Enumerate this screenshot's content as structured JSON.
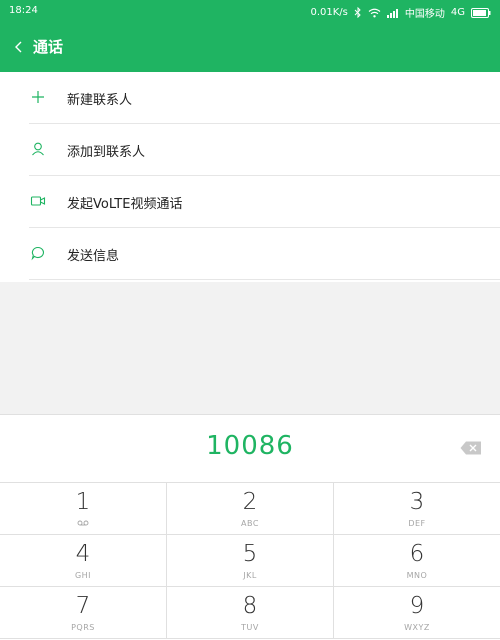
{
  "status": {
    "time": "18:24",
    "speed": "0.01K/s",
    "carrier": "中国移动",
    "network": "4G"
  },
  "appbar": {
    "title": "通话"
  },
  "menu": [
    {
      "label": "新建联系人",
      "icon": "plus-icon"
    },
    {
      "label": "添加到联系人",
      "icon": "person-icon"
    },
    {
      "label": "发起VoLTE视频通话",
      "icon": "video-camera-icon"
    },
    {
      "label": "发送信息",
      "icon": "message-bubble-icon"
    }
  ],
  "dialer": {
    "number": "10086"
  },
  "keys": [
    {
      "digit": "1",
      "sub": "ꝏ"
    },
    {
      "digit": "2",
      "sub": "ABC"
    },
    {
      "digit": "3",
      "sub": "DEF"
    },
    {
      "digit": "4",
      "sub": "GHI"
    },
    {
      "digit": "5",
      "sub": "JKL"
    },
    {
      "digit": "6",
      "sub": "MNO"
    },
    {
      "digit": "7",
      "sub": "PQRS"
    },
    {
      "digit": "8",
      "sub": "TUV"
    },
    {
      "digit": "9",
      "sub": "WXYZ"
    }
  ],
  "colors": {
    "accent": "#1fb462",
    "text": "#222222",
    "subtext": "#a5a5a5"
  }
}
